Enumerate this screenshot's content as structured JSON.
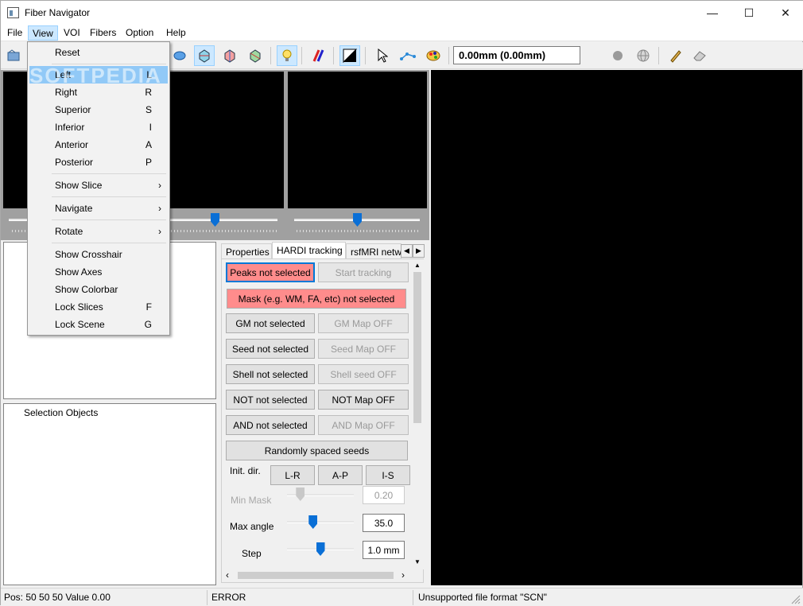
{
  "window": {
    "title": "Fiber Navigator",
    "minimize": "—",
    "maximize": "☐",
    "close": "✕"
  },
  "menubar": {
    "items": [
      "File",
      "View",
      "VOI",
      "Fibers",
      "Option",
      "Help"
    ]
  },
  "toolbar": {
    "coord_display": "0.00mm (0.00mm)"
  },
  "tabs": {
    "items": [
      "Properties",
      "HARDI tracking",
      "rsfMRI netw"
    ],
    "active": 1
  },
  "tracking": {
    "peaks": "Peaks not selected",
    "start": "Start tracking",
    "mask": "Mask (e.g. WM, FA, etc) not selected",
    "gm": "GM not selected",
    "gm_map": "GM Map OFF",
    "seed": "Seed not selected",
    "seed_map": "Seed Map OFF",
    "shell": "Shell not selected",
    "shell_seed": "Shell seed OFF",
    "not": "NOT not selected",
    "not_map": "NOT Map OFF",
    "and": "AND not selected",
    "and_map": "AND Map OFF",
    "random_seeds": "Randomly spaced seeds",
    "init_dir_label": "Init. dir.",
    "dir_lr": "L-R",
    "dir_ap": "A-P",
    "dir_is": "I-S",
    "min_mask_label": "Min Mask",
    "min_mask_value": "0.20",
    "min_mask_level": 0.2,
    "max_angle_label": "Max angle",
    "max_angle_value": "35.0",
    "max_angle_level": 0.39,
    "step_label": "Step",
    "step_value": "1.0 mm",
    "step_level": 0.5
  },
  "selection_panel": {
    "header": "Selection Objects"
  },
  "status": {
    "pos": "Pos: 50  50  50 Value 0.00",
    "error": "ERROR",
    "message": "Unsupported file format \"SCN\""
  },
  "view_menu": {
    "items": [
      {
        "label": "Reset",
        "key": ""
      },
      {
        "label": "Left",
        "key": "L"
      },
      {
        "label": "Right",
        "key": "R"
      },
      {
        "label": "Superior",
        "key": "S"
      },
      {
        "label": "Inferior",
        "key": "I"
      },
      {
        "label": "Anterior",
        "key": "A"
      },
      {
        "label": "Posterior",
        "key": "P"
      },
      {
        "label": "Show Slice",
        "key": "›"
      },
      {
        "label": "Navigate",
        "key": "›"
      },
      {
        "label": "Rotate",
        "key": "›"
      },
      {
        "label": "Show Crosshair",
        "key": ""
      },
      {
        "label": "Show Axes",
        "key": ""
      },
      {
        "label": "Show Colorbar",
        "key": ""
      },
      {
        "label": "Lock Slices",
        "key": "F"
      },
      {
        "label": "Lock Scene",
        "key": "G"
      }
    ],
    "highlighted": 1
  },
  "watermark": "SOFTPEDIA",
  "colors": {
    "accent": "#0078d7",
    "warning_fill": "#ff8c8c",
    "slider_thumb": "#0a6fd6",
    "view_bg": "#000000"
  }
}
